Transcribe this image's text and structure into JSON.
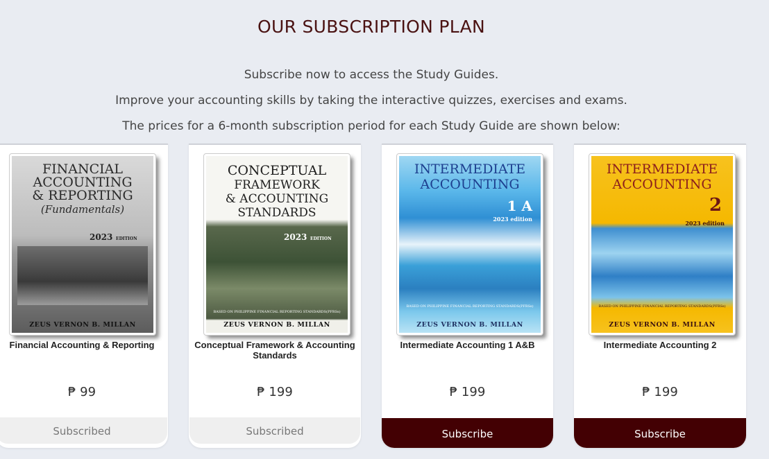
{
  "header": {
    "title": "OUR SUBSCRIPTION PLAN",
    "lines": [
      "Subscribe now to access the Study Guides.",
      "Improve your accounting skills by taking the interactive quizzes, exercises and exams.",
      "The prices for a 6-month subscription period for each Study Guide are shown below:"
    ]
  },
  "products": [
    {
      "name": "Financial Accounting & Reporting",
      "price": "₱ 99",
      "button": "Subscribed",
      "cover": {
        "line1": "FINANCIAL",
        "line2": "ACCOUNTING",
        "line3": "& REPORTING",
        "line4": "(Fundamentals)",
        "year": "2023",
        "edition": "EDITION",
        "author": "ZEUS VERNON B. MILLAN"
      }
    },
    {
      "name": "Conceptual Framework & Accounting Standards",
      "price": "₱ 199",
      "button": "Subscribed",
      "cover": {
        "line1": "CONCEPTUAL",
        "line2": "FRAMEWORK",
        "line3": "& ACCOUNTING",
        "line4": "STANDARDS",
        "year": "2023",
        "edition": "EDITION",
        "based": "BASED ON PHILIPPINE FINANCIAL REPORTING STANDARDS(PFRSs)",
        "author": "ZEUS VERNON B. MILLAN"
      }
    },
    {
      "name": "Intermediate Accounting 1 A&B",
      "price": "₱ 199",
      "button": "Subscribe",
      "cover": {
        "line1": "INTERMEDIATE",
        "line2": "ACCOUNTING",
        "volume": "1 A",
        "edition": "2023 edition",
        "based": "BASED ON PHILIPPINE FINANCIAL REPORTING STANDARDS(PFRSs)",
        "author": "ZEUS VERNON B. MILLAN"
      }
    },
    {
      "name": "Intermediate Accounting 2",
      "price": "₱ 199",
      "button": "Subscribe",
      "cover": {
        "line1": "INTERMEDIATE",
        "line2": "ACCOUNTING",
        "volume": "2",
        "edition": "2023 edition",
        "based": "BASED ON PHILIPPINE FINANCIAL REPORTING STANDARDS(PFRSs)",
        "author": "ZEUS VERNON B. MILLAN"
      }
    }
  ],
  "colors": {
    "accent": "#430003",
    "title": "#4a1212",
    "background": "#e9ecf2",
    "subscribed_bg": "#efefef"
  }
}
